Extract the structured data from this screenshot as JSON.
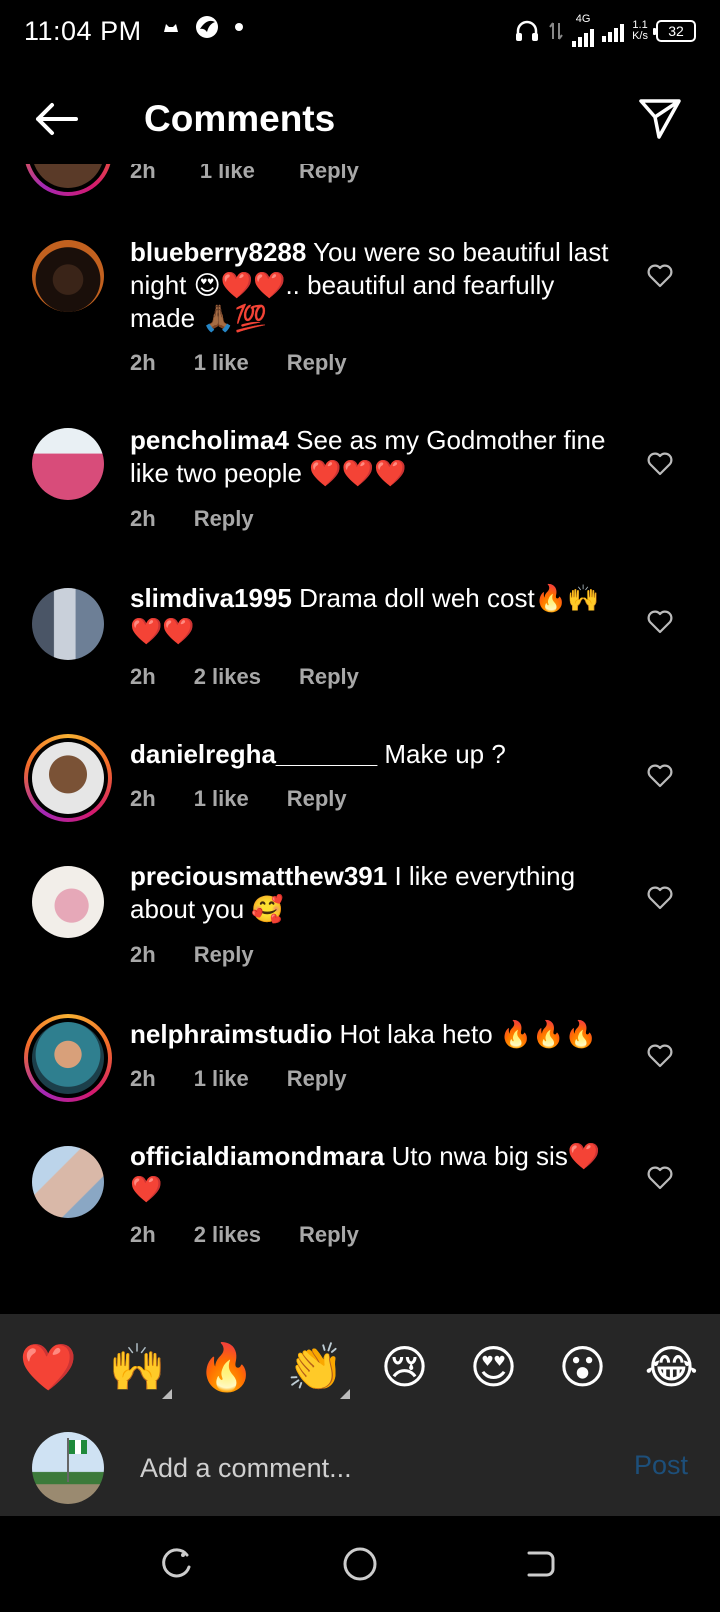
{
  "status_bar": {
    "time": "11:04 PM",
    "network_type": "4G",
    "speed_value": "1.1",
    "speed_unit": "K/s",
    "battery": "32"
  },
  "header": {
    "title": "Comments",
    "back_icon": "arrow-left-icon",
    "share_icon": "paper-plane-icon"
  },
  "top_partial": {
    "time": "2h",
    "likes": "1 like",
    "reply": "Reply"
  },
  "comments": [
    {
      "username": "blueberry8288",
      "text": "You were so beautiful last night 😍❤️❤️.. beautiful and fearfully made 🙏🏾💯",
      "time": "2h",
      "likes": "1 like",
      "reply": "Reply",
      "avatar_color": "#b4561f",
      "story_ring": false
    },
    {
      "username": "pencholima4",
      "text": "See as my Godmother fine like two people ❤️❤️❤️",
      "time": "2h",
      "likes": "",
      "reply": "Reply",
      "avatar_color": "#d84c7a",
      "story_ring": false
    },
    {
      "username": "slimdiva1995",
      "text": "Drama doll weh cost🔥🙌❤️❤️",
      "time": "2h",
      "likes": "2 likes",
      "reply": "Reply",
      "avatar_color": "#6d7f96",
      "story_ring": false
    },
    {
      "username": "danielregha_______",
      "text": "Make up ?",
      "time": "2h",
      "likes": "1 like",
      "reply": "Reply",
      "avatar_color": "#7a5236",
      "story_ring": true
    },
    {
      "username": "preciousmatthew391",
      "text": "I like everything about you 🥰",
      "time": "2h",
      "likes": "",
      "reply": "Reply",
      "avatar_color": "#e6a8b8",
      "story_ring": false
    },
    {
      "username": "nelphraimstudio",
      "text": "Hot laka heto 🔥🔥🔥",
      "time": "2h",
      "likes": "1 like",
      "reply": "Reply",
      "avatar_color": "#2f7f8f",
      "story_ring": true
    },
    {
      "username": "officialdiamondmara",
      "text": "Uto nwa big sis❤️❤️",
      "time": "2h",
      "likes": "2 likes",
      "reply": "Reply",
      "avatar_color": "#d9b8a8",
      "story_ring": false
    }
  ],
  "reactions": [
    "❤️",
    "🙌",
    "🔥",
    "👏",
    "😢",
    "😍",
    "😮",
    "😂"
  ],
  "composer": {
    "placeholder": "Add a comment...",
    "post_label": "Post"
  },
  "colors": {
    "background": "#000000",
    "panel": "#262626",
    "meta_text": "#a8a8a8",
    "post_disabled": "#1d4f7a"
  }
}
